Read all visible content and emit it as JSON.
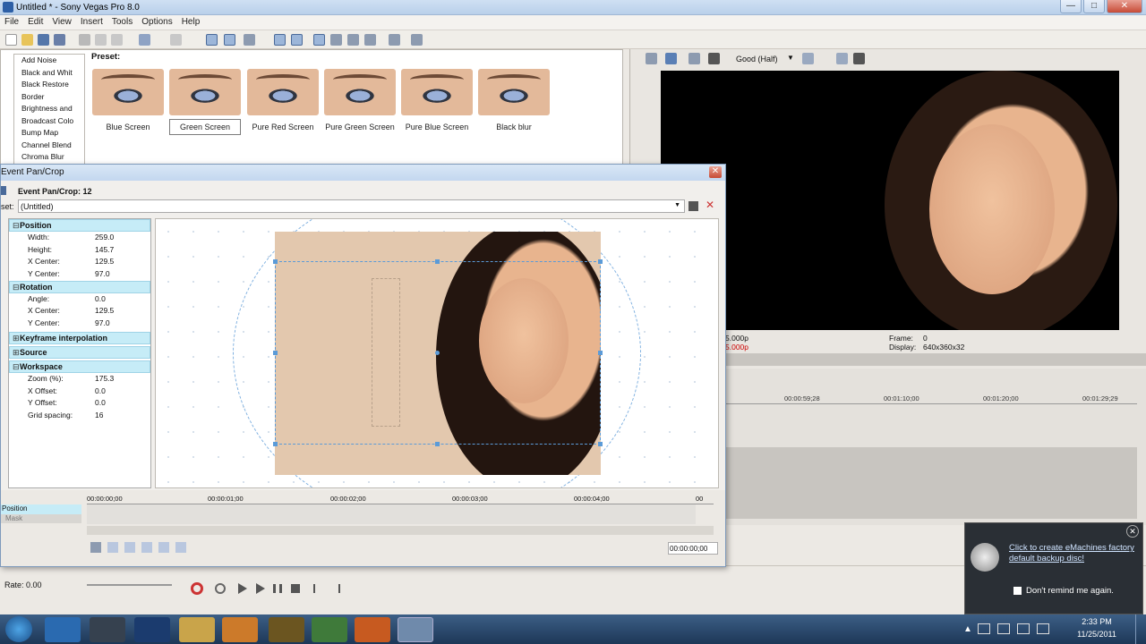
{
  "window": {
    "title": "Untitled * - Sony Vegas Pro 8.0",
    "buttons": [
      "—",
      "□",
      "✕"
    ]
  },
  "menu": [
    "File",
    "Edit",
    "View",
    "Insert",
    "Tools",
    "Options",
    "Help"
  ],
  "fx_list": [
    "Add Noise",
    "Black and Whit",
    "Black Restore",
    "Border",
    "Brightness and",
    "Broadcast Colo",
    "Bump Map",
    "Channel Blend",
    "Chroma Blur"
  ],
  "presets": {
    "label": "Preset:",
    "items": [
      "Blue Screen",
      "Green Screen",
      "Pure Red Screen",
      "Pure Green Screen",
      "Pure Blue Screen",
      "Black blur"
    ],
    "selected_index": 1
  },
  "preview": {
    "quality": "Good (Half)",
    "info": {
      "left_line1": "5.000p",
      "left_line2": "5.000p",
      "frame_label": "Frame:",
      "frame_value": "0",
      "display_label": "Display:",
      "display_value": "640x360x32"
    }
  },
  "timeline_ruler": [
    "00:00:59;28",
    "00:01:10;00",
    "00:01:20;00",
    "00:01:29;29"
  ],
  "dialog": {
    "title": "Event Pan/Crop",
    "subtitle": "Event Pan/Crop: 12",
    "preset_label": "set:",
    "preset_value": "(Untitled)",
    "sections": [
      {
        "name": "Position",
        "expanded": true,
        "rows": [
          {
            "k": "Width:",
            "v": "259.0"
          },
          {
            "k": "Height:",
            "v": "145.7"
          },
          {
            "k": "X Center:",
            "v": "129.5"
          },
          {
            "k": "Y Center:",
            "v": "97.0"
          }
        ]
      },
      {
        "name": "Rotation",
        "expanded": true,
        "rows": [
          {
            "k": "Angle:",
            "v": "0.0"
          },
          {
            "k": "X Center:",
            "v": "129.5"
          },
          {
            "k": "Y Center:",
            "v": "97.0"
          }
        ]
      },
      {
        "name": "Keyframe interpolation",
        "expanded": false,
        "rows": []
      },
      {
        "name": "Source",
        "expanded": false,
        "rows": []
      },
      {
        "name": "Workspace",
        "expanded": true,
        "rows": [
          {
            "k": "Zoom (%):",
            "v": "175.3"
          },
          {
            "k": "X Offset:",
            "v": "0.0"
          },
          {
            "k": "Y Offset:",
            "v": "0.0"
          },
          {
            "k": "Grid spacing:",
            "v": "16"
          }
        ]
      }
    ],
    "ruler": [
      "00:00:00;00",
      "00:00:01;00",
      "00:00:02;00",
      "00:00:03;00",
      "00:00:04;00",
      "00"
    ],
    "tracks": [
      "Position",
      "Mask"
    ],
    "time": "00:00:00;00"
  },
  "transport": {
    "rate": "Rate: 0.00"
  },
  "notification": {
    "link": "Click to create eMachines factory default backup disc!",
    "checkbox": "Don't remind me again."
  },
  "clock": {
    "time": "2:33 PM",
    "date": "11/25/2011"
  },
  "colors": {
    "accent_cyan": "#c6ecf7",
    "title_blue": "#c3d7ef",
    "taskbar": "#1d3757"
  }
}
